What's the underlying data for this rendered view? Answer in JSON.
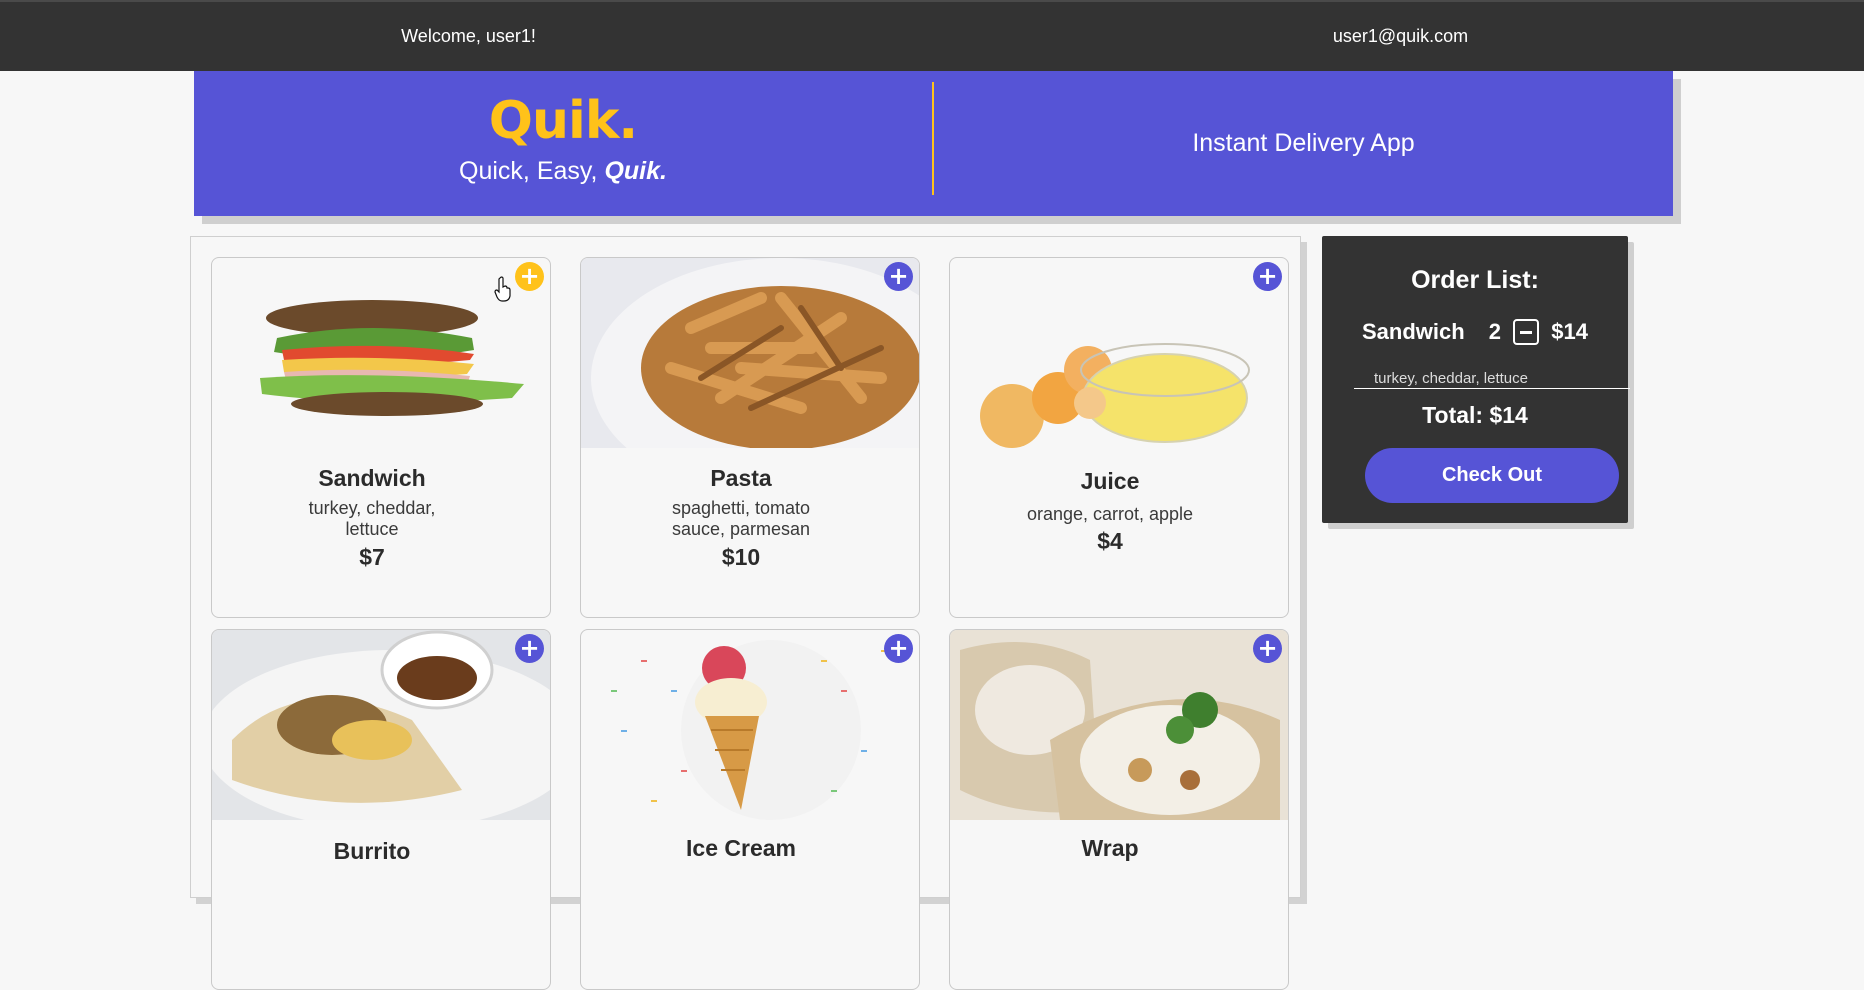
{
  "topbar": {
    "welcome": "Welcome, user1!",
    "email": "user1@quik.com"
  },
  "hero": {
    "logo": "Quik.",
    "tagline_prefix": "Quick, Easy, ",
    "tagline_emphasis": "Quik.",
    "subtitle": "Instant Delivery App"
  },
  "menu": {
    "items": [
      {
        "name": "Sandwich",
        "desc": "turkey, cheddar, lettuce",
        "price": "$7",
        "icon": "plus-icon"
      },
      {
        "name": "Pasta",
        "desc": "spaghetti, tomato sauce, parmesan",
        "price": "$10",
        "icon": "plus-icon"
      },
      {
        "name": "Juice",
        "desc": "orange, carrot, apple",
        "price": "$4",
        "icon": "plus-icon"
      },
      {
        "name": "Burrito",
        "icon": "plus-icon"
      },
      {
        "name": "Ice Cream",
        "icon": "plus-icon"
      },
      {
        "name": "Wrap",
        "icon": "plus-icon"
      }
    ],
    "add_glyph": "+"
  },
  "order": {
    "title": "Order List:",
    "item_name": "Sandwich",
    "item_qty": "2",
    "item_price": "$14",
    "item_note": "turkey, cheddar, lettuce",
    "total": "Total: $14",
    "checkout_label": "Check Out"
  },
  "colors": {
    "brand_purple": "#5654d6",
    "accent_yellow": "#ffc21a",
    "dark_bar": "#333333"
  }
}
